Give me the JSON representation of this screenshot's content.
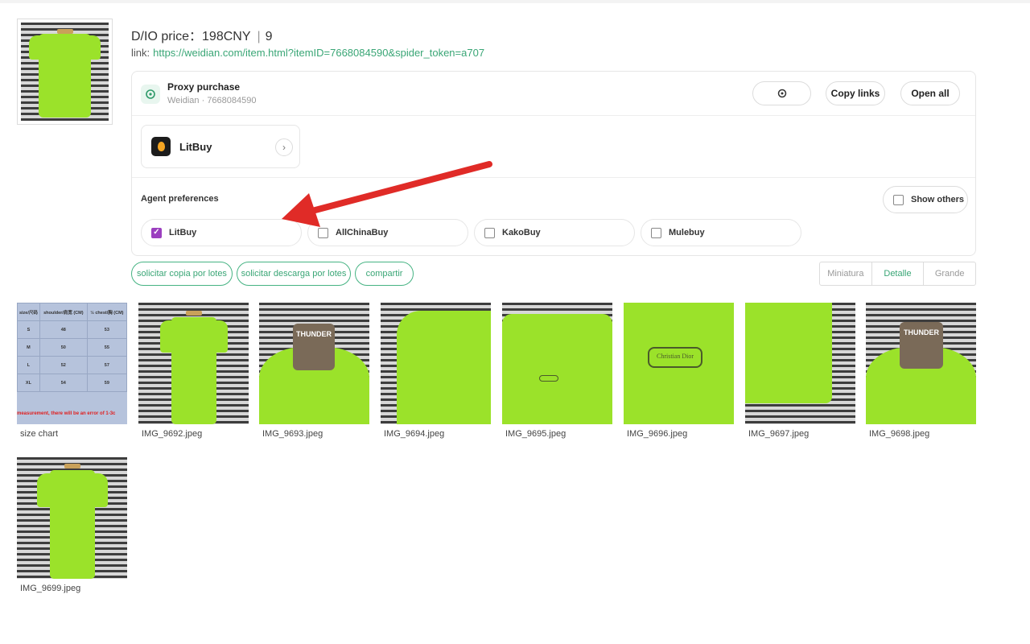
{
  "product": {
    "title": "D/IO price：198CNY",
    "count": "9",
    "link_label": "link:",
    "link_url": "https://weidian.com/item.html?itemID=7668084590&spider_token=a707"
  },
  "proxy": {
    "title": "Proxy purchase",
    "subtitle": "Weidian · 7668084590",
    "copy_links_label": "Copy links",
    "open_all_label": "Open all"
  },
  "agent": {
    "name": "LitBuy"
  },
  "preferences": {
    "label": "Agent preferences",
    "show_others_label": "Show others",
    "options": [
      {
        "label": "LitBuy",
        "checked": true
      },
      {
        "label": "AllChinaBuy",
        "checked": false
      },
      {
        "label": "KakoBuy",
        "checked": false
      },
      {
        "label": "Mulebuy",
        "checked": false
      }
    ]
  },
  "actions": {
    "copy_batch": "solicitar copia por lotes",
    "download_batch": "solicitar descarga por lotes",
    "share": "compartir"
  },
  "view_modes": {
    "items": [
      "Miniatura",
      "Detalle",
      "Grande"
    ],
    "active": "Detalle"
  },
  "size_chart": {
    "headers": [
      "size/尺码",
      "shoulder/肩宽 (CM)",
      "½ chest/胸 (CM)"
    ],
    "rows": [
      [
        "S",
        "48",
        "53"
      ],
      [
        "M",
        "50",
        "55"
      ],
      [
        "L",
        "52",
        "57"
      ],
      [
        "XL",
        "54",
        "59"
      ]
    ],
    "note": "measurement, there will be an error of 1-3c"
  },
  "gallery": [
    {
      "caption": "size chart",
      "icon": "size-chart-image"
    },
    {
      "caption": "IMG_9692.jpeg",
      "icon": "tshirt-front-image"
    },
    {
      "caption": "IMG_9693.jpeg",
      "icon": "collar-label-image"
    },
    {
      "caption": "IMG_9694.jpeg",
      "icon": "sleeve-detail-image"
    },
    {
      "caption": "IMG_9695.jpeg",
      "icon": "chest-logo-image"
    },
    {
      "caption": "IMG_9696.jpeg",
      "icon": "logo-closeup-image"
    },
    {
      "caption": "IMG_9697.jpeg",
      "icon": "hem-detail-image"
    },
    {
      "caption": "IMG_9698.jpeg",
      "icon": "collar-label-image"
    },
    {
      "caption": "IMG_9699.jpeg",
      "icon": "tshirt-back-image"
    }
  ],
  "image_text": {
    "collar_label": "THUNDER",
    "logo_text": "Christian Dior"
  },
  "colors": {
    "accent": "#3aa676",
    "checkbox": "#9b3fbf",
    "arrow": "#e02b27",
    "shirt": "#9be22a"
  }
}
